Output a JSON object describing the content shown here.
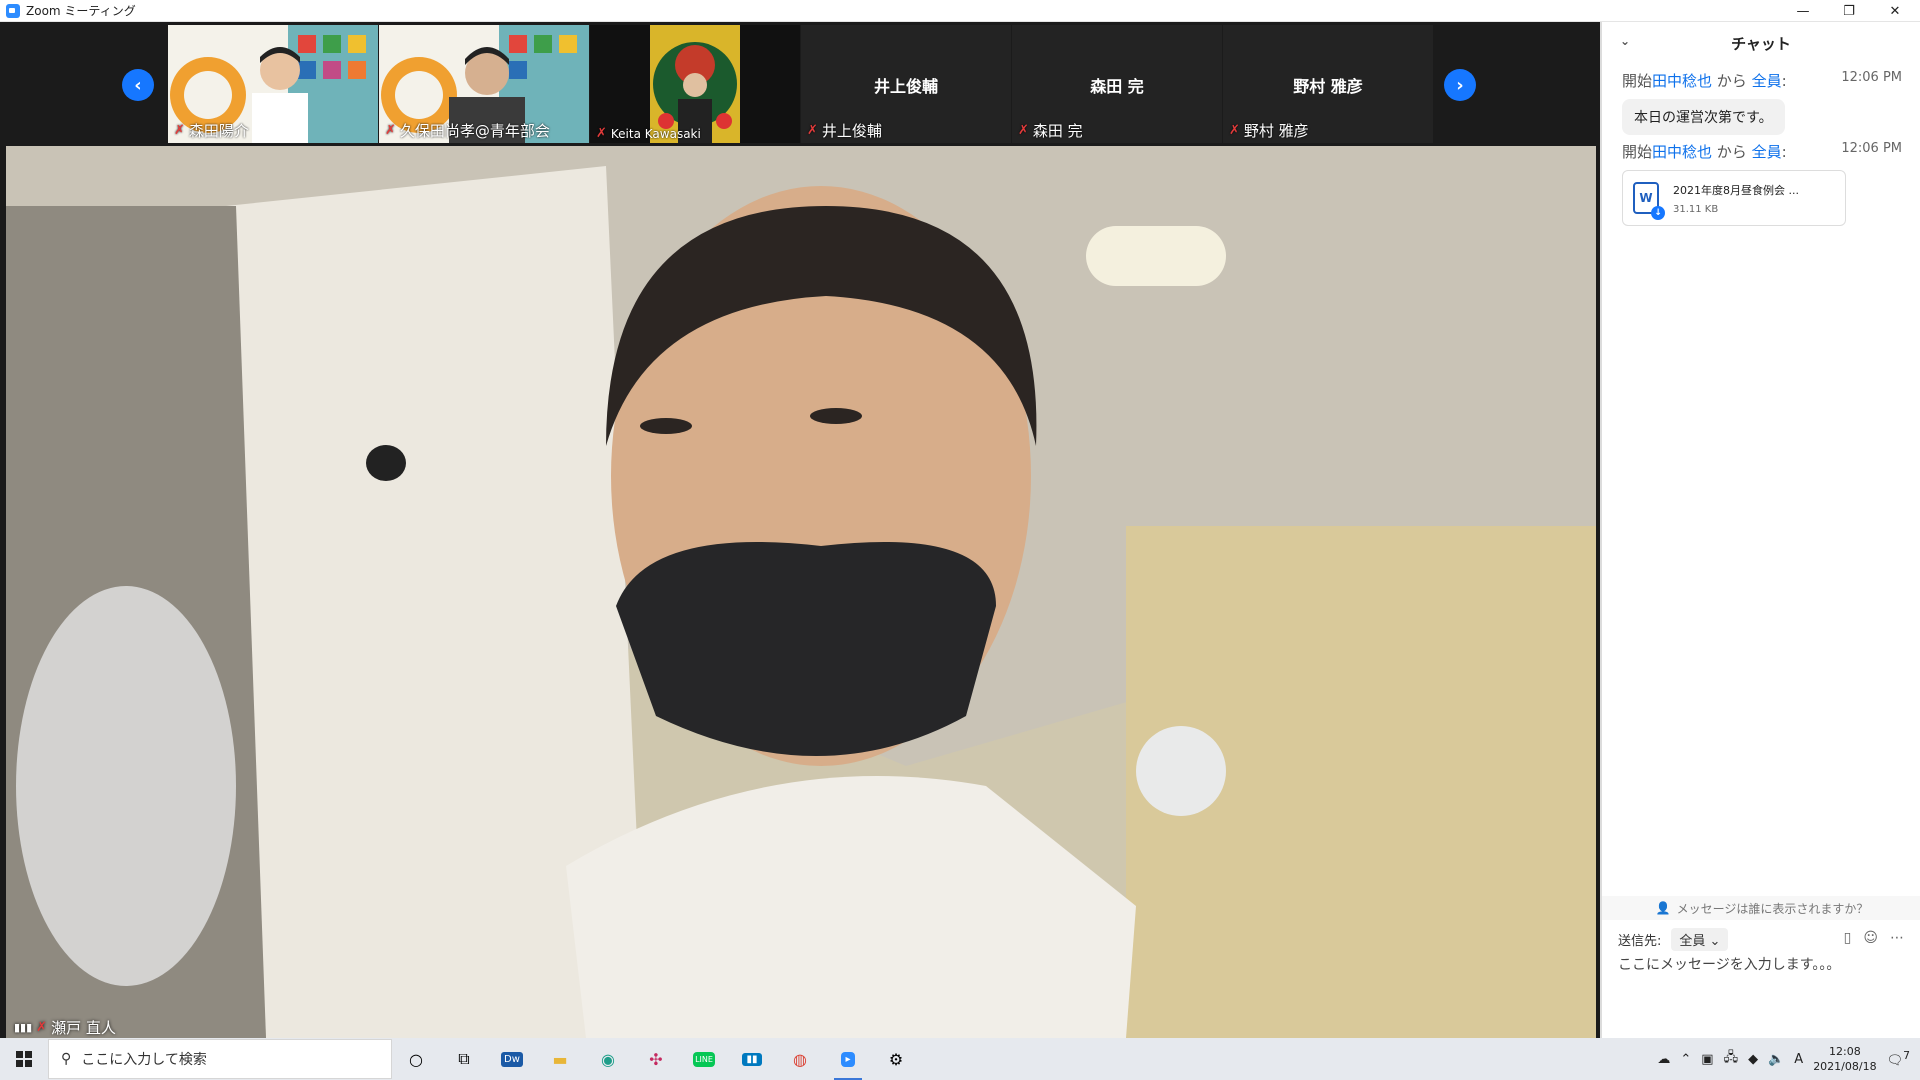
{
  "window": {
    "title": "Zoom ミーティング"
  },
  "strip": {
    "participants": [
      {
        "name": "森田陽介",
        "has_video": true
      },
      {
        "name": "久保田尚孝@青年部会",
        "has_video": true
      },
      {
        "name": "Keita Kawasaki",
        "has_video": true
      },
      {
        "name": "井上俊輔",
        "display_name": "井上俊輔",
        "has_video": false
      },
      {
        "name": "森田 完",
        "display_name": "森田 完",
        "has_video": false
      },
      {
        "name": "野村 雅彦",
        "display_name": "野村 雅彦",
        "has_video": false
      }
    ],
    "prev_icon": "chevron-left-icon",
    "next_icon": "chevron-right-icon"
  },
  "main_video": {
    "name": "瀬戸 直人"
  },
  "chat": {
    "title": "チャット",
    "messages": [
      {
        "prefix": "開始",
        "from": "田中稔也",
        "mid": " から ",
        "to": "全員",
        "suffix": ":",
        "time": "12:06 PM",
        "text": "本日の運営次第です。"
      },
      {
        "prefix": "開始",
        "from": "田中稔也",
        "mid": " から ",
        "to": "全員",
        "suffix": ":",
        "time": "12:06 PM",
        "file_name": "2021年度8月昼食例会 ...",
        "file_size": "31.11 KB",
        "file_letter": "W"
      }
    ],
    "privacy_text": "メッセージは誰に表示されますか？",
    "send_to_label": "送信先:",
    "send_to_value": "全員",
    "input_placeholder": "ここにメッセージを入力します。。。"
  },
  "taskbar": {
    "search_placeholder": "ここに入力して検索",
    "time": "12:08",
    "date": "2021/08/18",
    "ime": "A",
    "notification_count": "7"
  },
  "colors": {
    "accent": "#0e71eb",
    "muted": "#e23b3b",
    "nav": "#1677ff"
  }
}
